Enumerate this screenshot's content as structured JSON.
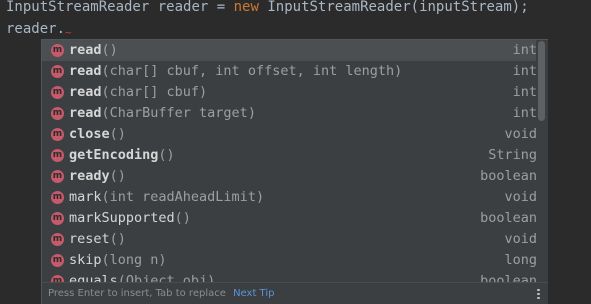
{
  "editor": {
    "line1": {
      "type_name": "InputStreamReader",
      "var_name": "reader",
      "equals": "=",
      "new_kw": "new",
      "ctor_call": "InputStreamReader(inputStream);"
    },
    "line2": {
      "text": "reader.",
      "squiggle": "~"
    }
  },
  "completion": {
    "items": [
      {
        "name": "read",
        "params": "()",
        "ret": "int",
        "bold": true,
        "selected": true
      },
      {
        "name": "read",
        "params": "(char[] cbuf, int offset, int length)",
        "ret": "int",
        "bold": true
      },
      {
        "name": "read",
        "params": "(char[] cbuf)",
        "ret": "int",
        "bold": true
      },
      {
        "name": "read",
        "params": "(CharBuffer target)",
        "ret": "int",
        "bold": true
      },
      {
        "name": "close",
        "params": "()",
        "ret": "void",
        "bold": true
      },
      {
        "name": "getEncoding",
        "params": "()",
        "ret": "String",
        "bold": true
      },
      {
        "name": "ready",
        "params": "()",
        "ret": "boolean",
        "bold": true
      },
      {
        "name": "mark",
        "params": "(int readAheadLimit)",
        "ret": "void",
        "bold": false
      },
      {
        "name": "markSupported",
        "params": "()",
        "ret": "boolean",
        "bold": false
      },
      {
        "name": "reset",
        "params": "()",
        "ret": "void",
        "bold": false
      },
      {
        "name": "skip",
        "params": "(long n)",
        "ret": "long",
        "bold": false
      },
      {
        "name": "equals",
        "params": "(Object obj)",
        "ret": "boolean",
        "bold": false
      }
    ],
    "icon_letter": "m",
    "footer": {
      "hint": "Press Enter to insert, Tab to replace",
      "tip_link": "Next Tip"
    }
  },
  "colors": {
    "editor_bg": "#2b2b2b",
    "popup_bg": "#3c3f41",
    "selected_bg": "#4b4f52",
    "method_icon": "#c55a6b",
    "keyword": "#cc7832",
    "link": "#5894d6"
  },
  "icons": {
    "method": "method-m-icon",
    "more": "vertical-dots-icon"
  }
}
